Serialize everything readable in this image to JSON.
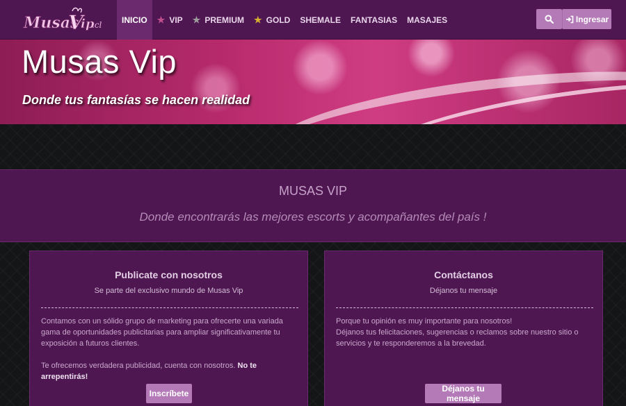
{
  "brand": {
    "logo_text": "MusasVip.cl"
  },
  "nav": {
    "items": [
      {
        "label": "INICIO",
        "active": true,
        "icon": ""
      },
      {
        "label": "VIP",
        "active": false,
        "icon": "star-icon"
      },
      {
        "label": "PREMIUM",
        "active": false,
        "icon": "star-icon"
      },
      {
        "label": "GOLD",
        "active": false,
        "icon": "star-icon"
      },
      {
        "label": "SHEMALE",
        "active": false,
        "icon": ""
      },
      {
        "label": "FANTASIAS",
        "active": false,
        "icon": ""
      },
      {
        "label": "MASAJES",
        "active": false,
        "icon": ""
      }
    ],
    "search_icon": "search-icon",
    "login_label": "Ingresar",
    "login_icon": "sign-in-icon"
  },
  "hero": {
    "title": "Musas Vip",
    "subtitle": "Donde tus fantasías se hacen realidad"
  },
  "intro": {
    "title": "MUSAS VIP",
    "tagline": "Donde encontrarás las mejores escorts y acompañantes del país !"
  },
  "cards": {
    "publish": {
      "title": "Publicate con nosotros",
      "subtitle": "Se parte del exclusivo mundo de Musas Vip",
      "body_1": "Contamos con un sólido grupo de marketing para ofrecerte una variada gama de oportunidades publicitarias para ampliar significativamente tu exposición a futuros clientes.",
      "body_2": "Te ofrecemos verdadera publicidad, cuenta con nosotros.",
      "body_2_strong": "No te arrepentirás!",
      "button": "Inscríbete"
    },
    "contact": {
      "title": "Contáctanos",
      "subtitle": "Déjanos tu mensaje",
      "body_1": "Porque tu opinión es muy importante para nosotros!",
      "body_2": "Déjanos tus felicitaciones, sugerencias o reclamos sobre nuestro sitio o servicios y te responderemos a la brevedad.",
      "button": "Déjanos tu mensaje"
    }
  },
  "colors": {
    "nav_bg": "#4f1752",
    "nav_active": "#6a2a6d",
    "button": "#b47ab7",
    "vip_star": "#c04f8d",
    "premium_star": "#9d9d9d",
    "gold_star": "#d8b030"
  }
}
